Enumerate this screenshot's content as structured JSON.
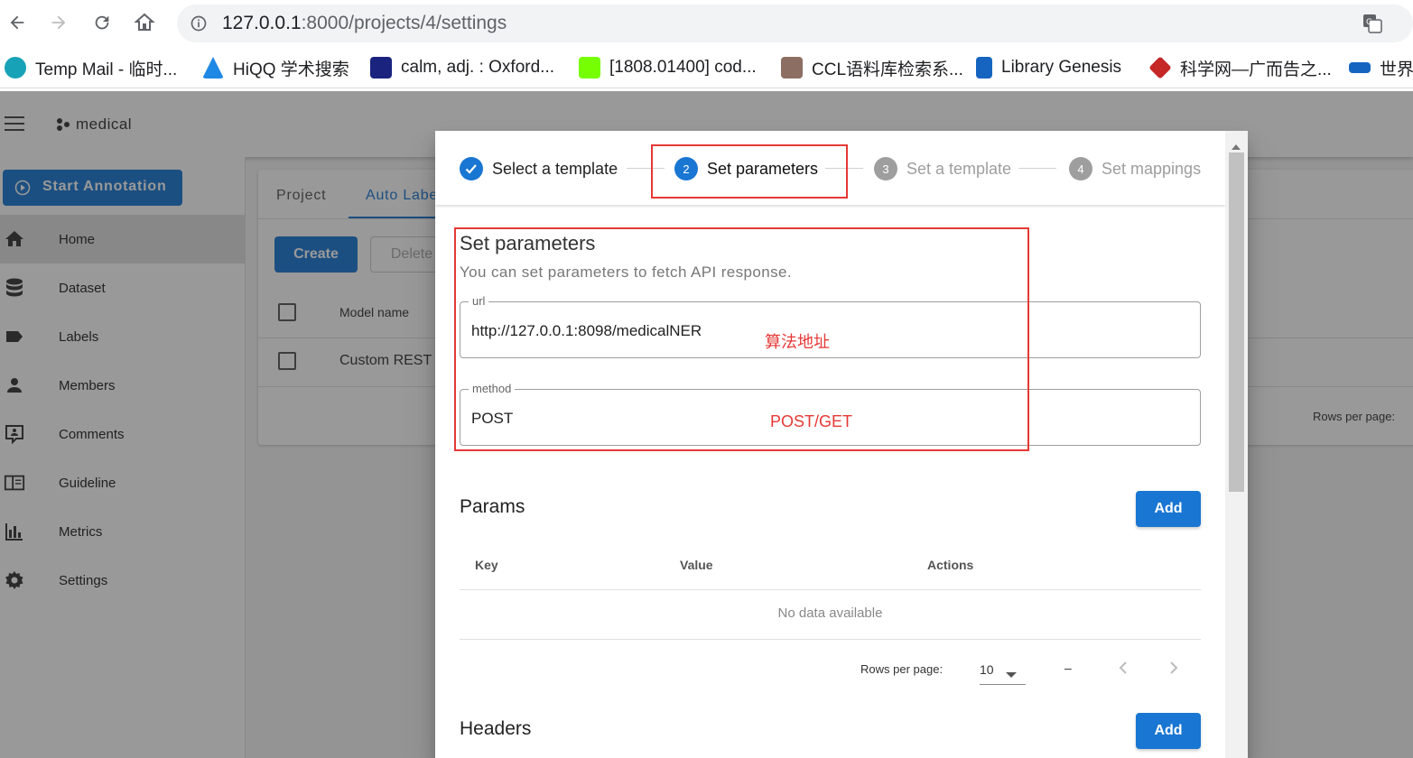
{
  "browser": {
    "url_host": "127.0.0.1",
    "url_rest": ":8000/projects/4/settings",
    "bookmarks": [
      {
        "label": "Temp Mail - 临时...",
        "color": "#17a2b8"
      },
      {
        "label": "HiQQ 学术搜索",
        "color": "#1e88e5"
      },
      {
        "label": "calm, adj. : Oxford...",
        "color": "#1a237e"
      },
      {
        "label": "[1808.01400] cod...",
        "color": "#76ff03"
      },
      {
        "label": "CCL语料库检索系...",
        "color": "#8d6e63"
      },
      {
        "label": "Library Genesis",
        "color": "#1565c0"
      },
      {
        "label": "科学网—广而告之...",
        "color": "#c62828"
      },
      {
        "label": "世界",
        "color": "#1565c0"
      }
    ]
  },
  "app": {
    "project_name": "medical",
    "start_button": "Start Annotation",
    "sidebar": [
      {
        "label": "Home",
        "icon": "home-icon"
      },
      {
        "label": "Dataset",
        "icon": "database-icon"
      },
      {
        "label": "Labels",
        "icon": "label-icon"
      },
      {
        "label": "Members",
        "icon": "account-icon"
      },
      {
        "label": "Comments",
        "icon": "comment-icon"
      },
      {
        "label": "Guideline",
        "icon": "book-icon"
      },
      {
        "label": "Metrics",
        "icon": "chart-icon"
      },
      {
        "label": "Settings",
        "icon": "gear-icon"
      }
    ],
    "tabs": [
      "Project",
      "Auto Labe"
    ],
    "create_button": "Create",
    "delete_button": "Delete",
    "table_header_model": "Model name",
    "table_row_model": "Custom REST R",
    "rows_per_page": "Rows per page:"
  },
  "dialog": {
    "steps": [
      {
        "number": "✓",
        "label": "Select a template",
        "state": "done"
      },
      {
        "number": "2",
        "label": "Set parameters",
        "state": "active"
      },
      {
        "number": "3",
        "label": "Set a template",
        "state": "inactive"
      },
      {
        "number": "4",
        "label": "Set mappings",
        "state": "inactive"
      }
    ],
    "title": "Set parameters",
    "subtitle": "You can set parameters to fetch API response.",
    "url_label": "url",
    "url_value": "http://127.0.0.1:8098/medicalNER",
    "method_label": "method",
    "method_value": "POST",
    "annotation_url": "算法地址",
    "annotation_method": "POST/GET",
    "params": {
      "title": "Params",
      "add": "Add",
      "columns": [
        "Key",
        "Value",
        "Actions"
      ],
      "empty": "No data available",
      "rows_per_page_label": "Rows per page:",
      "rows_per_page_value": "10",
      "range": "–"
    },
    "headers": {
      "title": "Headers",
      "add": "Add"
    }
  },
  "colors": {
    "primary": "#1976d2",
    "annotation": "#e53935"
  }
}
